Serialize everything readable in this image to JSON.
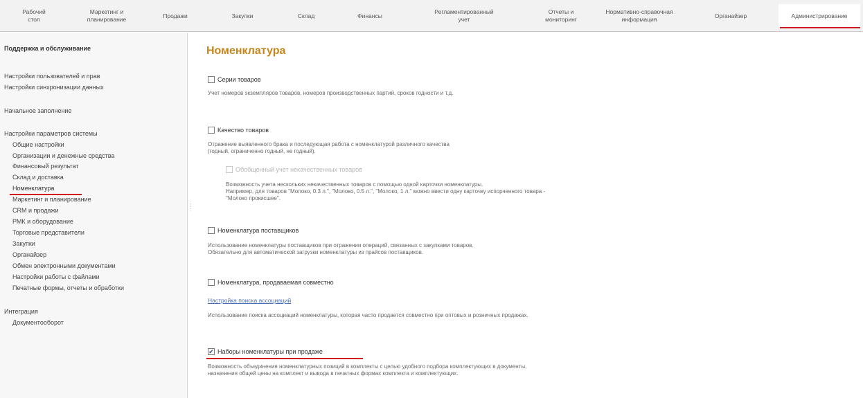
{
  "top_menu": [
    {
      "label": "Рабочий\nстол"
    },
    {
      "label": "Маркетинг и\nпланирование"
    },
    {
      "label": "Продажи"
    },
    {
      "label": "Закупки"
    },
    {
      "label": "Склад"
    },
    {
      "label": "Финансы"
    },
    {
      "label": "Регламентированный\nучет"
    },
    {
      "label": "Отчеты и\nмониторинг"
    },
    {
      "label": "Нормативно-справочная\nинформация"
    },
    {
      "label": "Органайзер"
    },
    {
      "label": "Администрирование"
    }
  ],
  "sidebar": {
    "support_heading": "Поддержка и обслуживание",
    "users_rights": "Настройки пользователей и прав",
    "sync_settings": "Настройки синхронизации данных",
    "initial_fill": "Начальное заполнение",
    "system_params": "Настройки параметров системы",
    "items": [
      "Общие настройки",
      "Организации и денежные средства",
      "Финансовый результат",
      "Склад и доставка",
      "Номенклатура",
      "Маркетинг и планирование",
      "CRM и продажи",
      "РМК и оборудование",
      "Торговые представители",
      "Закупки",
      "Органайзер",
      "Обмен электронными документами",
      "Настройки работы с файлами",
      "Печатные формы, отчеты и обработки"
    ],
    "integration": "Интеграция",
    "docflow": "Документооборот"
  },
  "main": {
    "title": "Номенклатура",
    "series": {
      "label": "Серии товаров",
      "desc": "Учет номеров экземпляров товаров, номеров производственных партий, сроков годности и т.д."
    },
    "quality": {
      "label": "Качество товаров",
      "desc1": "Отражение выявленного брака и последующая работа с номенклатурой различного качества",
      "desc2": "(годный, ограниченно годный, не годный)."
    },
    "generalized": {
      "label": "Обобщенный учет некачественных товаров",
      "desc1": "Возможность учета нескольких некачественных товаров с помощью одной карточки номенклатуры.",
      "desc2": "Например, для товаров \"Молоко, 0.3 л.\", \"Молоко, 0.5 л.\", \"Молоко, 1 л.\" можно ввести одну карточку испорченного товара -",
      "desc3": "\"Молоко прокисшее\"."
    },
    "supplier": {
      "label": "Номенклатура поставщиков",
      "desc1": "Использование номенклатуры поставщиков при отражении операций, связанных с закупками товаров.",
      "desc2": "Обязательно для автоматической загрузки номенклатуры из прайсов поставщиков."
    },
    "together": {
      "label": "Номенклатура, продаваемая совместно",
      "link": "Настройка поиска ассоциаций",
      "desc": "Использование поиска ассоциаций номенклатуры, которая часто продается совместно при оптовых и розничных продажах."
    },
    "kits": {
      "label": "Наборы номенклатуры при продаже",
      "checked": true,
      "desc1": "Возможность объединения номенклатурных позиций в комплекты с целью удобного подбора комплектующих в документы,",
      "desc2": "назначения общей цены на комплект и вывода в печатных формах комплекта и комплектующих."
    }
  },
  "colors": {
    "accent_red": "#d2141c",
    "title": "#c6861e",
    "link": "#4a6fb6"
  }
}
